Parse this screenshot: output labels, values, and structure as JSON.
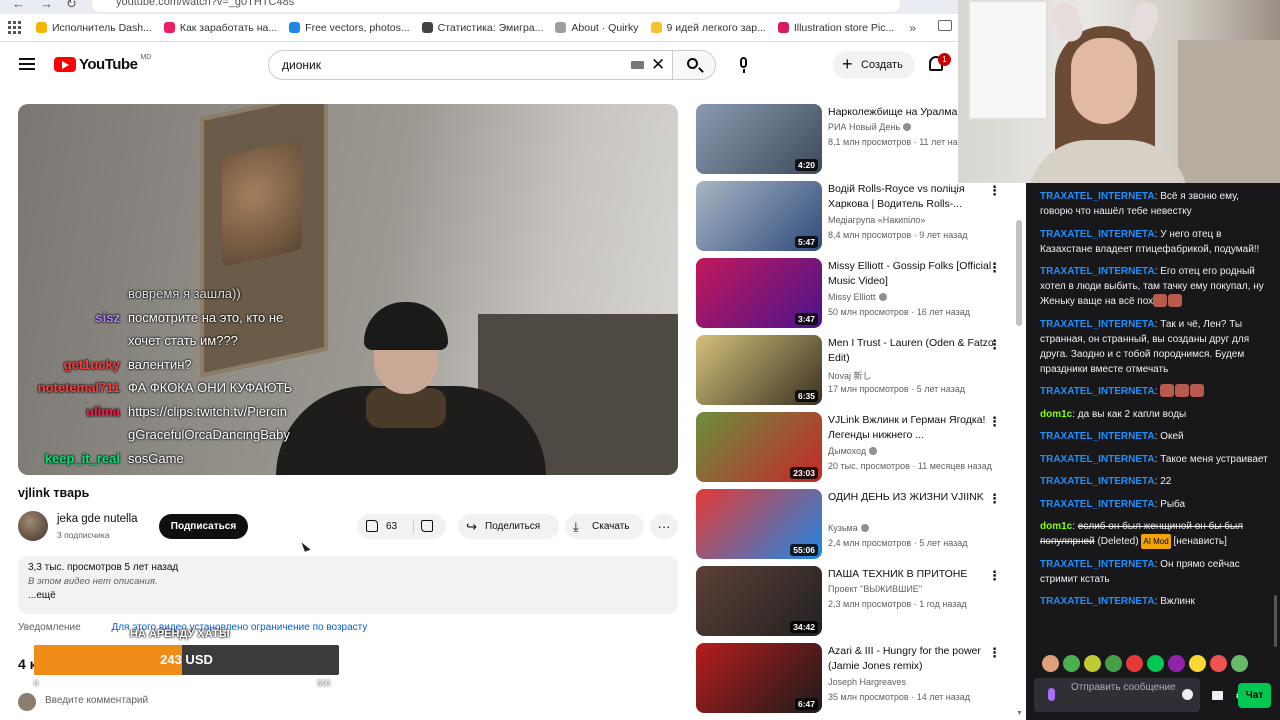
{
  "browser": {
    "url": "youtube.com/watch?v=_g0THTC48s",
    "bookmarks": [
      {
        "label": "Исполнитель Dash...",
        "color": "#f4b400"
      },
      {
        "label": "Как заработать на...",
        "color": "#e91e63"
      },
      {
        "label": "Free vectors, photos...",
        "color": "#1e88e5"
      },
      {
        "label": "Статистика: Эмигра...",
        "color": "#424242"
      },
      {
        "label": "About · Quirky",
        "color": "#9e9e9e"
      },
      {
        "label": "9 идей легкого зар...",
        "color": "#fbc02d"
      },
      {
        "label": "Illustration store Pic...",
        "color": "#d81b60"
      }
    ],
    "bookmarks_more": "»"
  },
  "header": {
    "logo_text": "YouTube",
    "logo_region": "MD",
    "search_value": "дионик",
    "create_label": "Создать",
    "notification_count": "1"
  },
  "player": {
    "overlay_chat": [
      {
        "user": "",
        "user_color": "#9aa0a6",
        "text": "вовремя я зашла))"
      },
      {
        "user": "sisz",
        "user_color": "#b388ff",
        "text": "посмотрите на это, кто не"
      },
      {
        "user": "",
        "user_color": "#ffffff",
        "text": "хочет стать им???"
      },
      {
        "user": "get1ucky",
        "user_color": "#ff3d3d",
        "text": "валентин?"
      },
      {
        "user": "notetemal711",
        "user_color": "#ff3d3d",
        "text": "ФА ФКОКА ОНИ КУФАЮТЬ"
      },
      {
        "user": "ulima",
        "user_color": "#ff1744",
        "text": "https://clips.twitch.tv/Piercin"
      },
      {
        "user": "",
        "user_color": "#ffffff",
        "text": "gGracefulOrcaDancingBaby"
      },
      {
        "user": "keep_it_real",
        "user_color": "#00e676",
        "text": "sosGame"
      }
    ]
  },
  "video": {
    "title": "vjlink тварь",
    "channel": "jeka gde nutella",
    "subscribers": "3 подписчика",
    "subscribe_label": "Подписаться",
    "likes": "63",
    "share_label": "Поделиться",
    "download_label": "Скачать",
    "more_label": "···",
    "views_date": "3,3 тыс. просмотров  5 лет назад",
    "no_description": "В этом видео нет описания.",
    "show_more": "...ещё",
    "notice_label": "Уведомление",
    "notice_link": "Для этого видео установлено ограничение по возрасту",
    "comments_count_partial": "4 к",
    "comment_placeholder": "Введите комментарий"
  },
  "donation": {
    "goal_title": "НА АРЕНДУ ХАТЫ",
    "amount_text": "243 USD",
    "min": "0",
    "max": "500",
    "progress": 0.486,
    "fill_color": "#ee8c17"
  },
  "recommended": [
    {
      "title": "Нарколежбище на Уралмаше",
      "channel": "РИА Новый День",
      "verified": true,
      "meta": "8,1 млн просмотров · 11 лет назад",
      "duration": "4:20",
      "thumb": [
        "#8b9bb0",
        "#3d4a5c"
      ]
    },
    {
      "title": "Водій Rolls-Royce vs поліція Харкова | Водитель Rolls-...",
      "channel": "Медіагрупа «Накипіло»",
      "verified": false,
      "meta": "8,4 млн просмотров · 9 лет назад",
      "duration": "5:47",
      "thumb": [
        "#a8b6c4",
        "#2f4b7c"
      ]
    },
    {
      "title": "Missy Elliott - Gossip Folks [Official Music Video]",
      "channel": "Missy Elliott",
      "verified": true,
      "meta": "50 млн просмотров · 16 лет назад",
      "duration": "3:47",
      "thumb": [
        "#c2185b",
        "#4a148c"
      ]
    },
    {
      "title": "Men I Trust - Lauren (Oden & Fatzo Edit)",
      "channel": "Novaj 新し",
      "verified": false,
      "meta": "17 млн просмотров · 5 лет назад",
      "duration": "6:35",
      "thumb": [
        "#d4c07a",
        "#3a3222"
      ]
    },
    {
      "title": "VJLink Вжлинк и Герман Ягодка! Легенды нижнего ...",
      "channel": "Дымоход",
      "verified": true,
      "meta": "20 тыс. просмотров · 11 месяцев назад",
      "duration": "23:03",
      "thumb": [
        "#6a8f3f",
        "#c62828"
      ]
    },
    {
      "title": "ОДИН ДЕНЬ ИЗ ЖИЗНИ VJIINK",
      "channel": "Кузьма",
      "verified": true,
      "meta": "2,4 млн просмотров · 5 лет назад",
      "duration": "55:06",
      "thumb": [
        "#e53935",
        "#1e88e5"
      ]
    },
    {
      "title": "ПАША ТЕХНИК В ПРИТОНЕ",
      "channel": "Проект \"ВЫЖИВШИЕ\"",
      "verified": false,
      "meta": "2,3 млн просмотров · 1 год назад",
      "duration": "34:42",
      "thumb": [
        "#5d4037",
        "#212121"
      ]
    },
    {
      "title": "Azari & III - Hungry for the power (Jamie Jones remix)",
      "channel": "Joseph Hargreaves",
      "verified": false,
      "meta": "35 млн просмотров · 14 лет назад",
      "duration": "6:47",
      "thumb": [
        "#b71c1c",
        "#1b1b1b"
      ]
    }
  ],
  "chat": {
    "messages": [
      {
        "user": "TRAXATEL_INTERNETA",
        "color": "#1e90ff",
        "text": "Всё я звоню ему, говорю что нашёл тебе невестку",
        "emotes": 0
      },
      {
        "user": "TRAXATEL_INTERNETA",
        "color": "#1e90ff",
        "text": "У него отец в Казахстане владеет птицефабрикой, подумай!!",
        "emotes": 0
      },
      {
        "user": "TRAXATEL_INTERNETA",
        "color": "#1e90ff",
        "text": "Его отец его родный хотел в люди выбить, там тачку ему покупал, ну Женьку ваще на всё пох",
        "emotes": 2
      },
      {
        "user": "TRAXATEL_INTERNETA",
        "color": "#1e90ff",
        "text": "Так и чё, Лен? Ты странная, он странный, вы созданы друг для друга. Заодно и с тобой породнимся. Будем праздники вместе отмечать",
        "emotes": 0
      },
      {
        "user": "TRAXATEL_INTERNETA",
        "color": "#1e90ff",
        "text": "",
        "emotes": 3
      },
      {
        "user": "dom1c",
        "color": "#7fff00",
        "text": "да вы как 2 капли воды",
        "emotes": 0
      },
      {
        "user": "TRAXATEL_INTERNETA",
        "color": "#1e90ff",
        "text": "Окей",
        "emotes": 0
      },
      {
        "user": "TRAXATEL_INTERNETA",
        "color": "#1e90ff",
        "text": "Такое меня устраивает",
        "emotes": 0
      },
      {
        "user": "TRAXATEL_INTERNETA",
        "color": "#1e90ff",
        "text": "22",
        "emotes": 0
      },
      {
        "user": "TRAXATEL_INTERNETA",
        "color": "#1e90ff",
        "text": "Рыба",
        "emotes": 0
      },
      {
        "user": "dom1c",
        "color": "#7fff00",
        "text": "",
        "deleted_text": "еслиб он был женщиной он бы был популярней",
        "deleted_label": "(Deleted)",
        "mod_badge": "AI Mod",
        "reason": "[ненависть]",
        "emotes": 0
      },
      {
        "user": "TRAXATEL_INTERNETA",
        "color": "#1e90ff",
        "text": "Он прямо сейчас стримит кстать",
        "emotes": 0
      },
      {
        "user": "TRAXATEL_INTERNETA",
        "color": "#1e90ff",
        "text": "Вжлинк",
        "emotes": 0
      }
    ],
    "emote_bar": [
      "#e0a080",
      "#4caf50",
      "#c0ca33",
      "#43a047",
      "#e53935",
      "#00c853",
      "#8e24aa",
      "#fdd835",
      "#ef5350",
      "#66bb6a"
    ],
    "input_placeholder": "Отправить сообщение",
    "send_label": "Чат"
  }
}
